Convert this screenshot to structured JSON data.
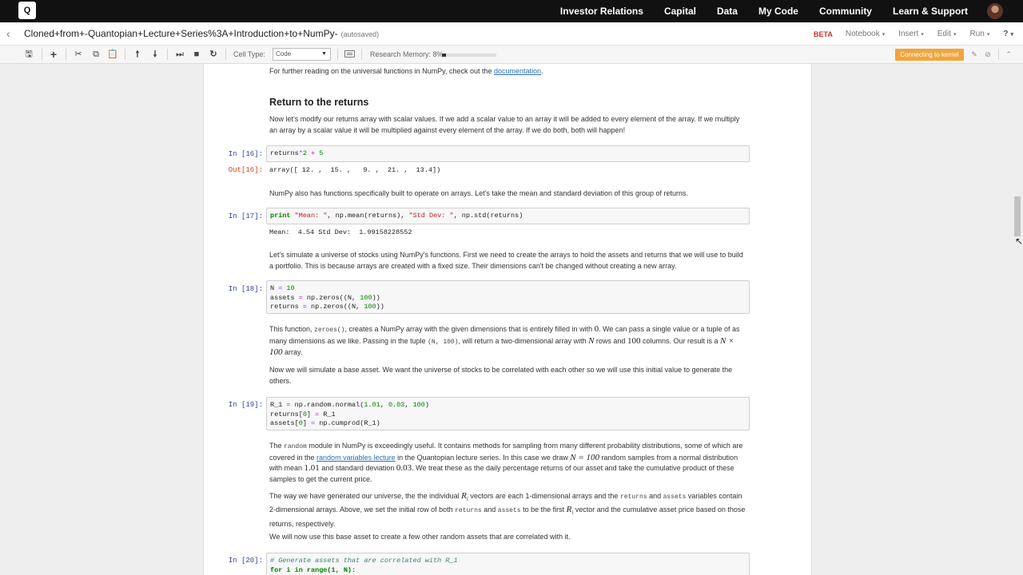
{
  "nav": {
    "logo": "Q",
    "links": [
      "Investor Relations",
      "Capital",
      "Data",
      "My Code",
      "Community",
      "Learn & Support"
    ]
  },
  "titlebar": {
    "title": "Cloned+from+-Quantopian+Lecture+Series%3A+Introduction+to+NumPy-",
    "autosaved": "(autosaved)",
    "beta": "BETA",
    "menus": [
      "Notebook",
      "Insert",
      "Edit",
      "Run",
      "?"
    ]
  },
  "toolbar": {
    "cell_type_label": "Cell Type:",
    "cell_type_value": "Code",
    "memory_label": "Research Memory: 8%",
    "memory_fraction": 0.08,
    "kernel_status": "Connecting to kernel",
    "kernel_color": "#f2a53a"
  },
  "notebook": {
    "md_doc_text": "For further reading on the universal functions in NumPy, check out the ",
    "md_doc_link": "documentation",
    "md_doc_end": ".",
    "heading": "Return to the returns",
    "md_scalar": "Now let's modify our returns array with scalar values. If we add a scalar value to an array it will be added to every element of the array. If we multiply an array by a scalar value it will be multiplied against every element of the array. If we do both, both will happen!",
    "prompt16": "In [16]:",
    "out16": "Out[16]:",
    "out16_text": "array([ 12. ,  15. ,   9. ,  21. ,  13.4])",
    "md_mean": "NumPy also has functions specifically built to operate on arrays. Let's take the mean and standard deviation of this group of returns.",
    "prompt17": "In [17]:",
    "out17_text": "Mean:  4.54 Std Dev:  1.99158228552",
    "md_simulate": "Let's simulate a universe of stocks using NumPy's functions. First we need to create the arrays to hold the assets and returns that we will use to build a portfolio. This is because arrays are created with a fixed size. Their dimensions can't be changed without creating a new array.",
    "prompt18": "In [18]:",
    "md_zeros_1": "This function, ",
    "md_zeros_code": "zeroes()",
    "md_zeros_2": ", creates a NumPy array with the given dimensions that is entirely filled in with ",
    "md_zeros_zero": "0",
    "md_zeros_3": ". We can pass a single value or a tuple of as many dimensions as we like. Passing in the tuple ",
    "md_zeros_tuple": "(N, 100)",
    "md_zeros_4": ", will return a two-dimensional array with ",
    "md_zeros_N": "N",
    "md_zeros_5": " rows and ",
    "md_zeros_100": "100",
    "md_zeros_6": " columns. Our result is a ",
    "md_zeros_dim": "N × 100",
    "md_zeros_7": " array.",
    "md_base": "Now we will simulate a base asset. We want the universe of stocks to be correlated with each other so we will use this initial value to generate the others.",
    "prompt19": "In [19]:",
    "md_random_1": "The ",
    "md_random_code": "random",
    "md_random_2": " module in NumPy is exceedingly useful. It contains methods for sampling from many different probability distributions, some of which are covered in the ",
    "md_random_link": "random variables lecture",
    "md_random_3": " in the Quantopian lecture series. In this case we draw ",
    "md_random_eq": "N = 100",
    "md_random_4": " random samples from a normal distribution with mean ",
    "md_random_mean": "1.01",
    "md_random_5": " and standard deviation ",
    "md_random_sd": "0.03",
    "md_random_6": ". We treat these as the daily percentage returns of our asset and take the cumulative product of these samples to get the current price.",
    "md_universe_1": "The way we have generated our universe, the the individual ",
    "md_universe_R": "R",
    "md_universe_i": "i",
    "md_universe_2": " vectors are each 1-dimensional arrays and the ",
    "md_universe_returns": "returns",
    "md_universe_3": " and ",
    "md_universe_assets": "assets",
    "md_universe_4": " variables contain 2-dimensional arrays. Above, we set the initial row of both ",
    "md_universe_returns2": "returns",
    "md_universe_5": " and ",
    "md_universe_assets2": "assets",
    "md_universe_6": " to be the first ",
    "md_universe_R2": "R",
    "md_universe_i2": "i",
    "md_universe_7": " vector and the cumulative asset price based on those returns, respectively.",
    "md_now": "We will now use this base asset to create a few other random assets that are correlated with it.",
    "prompt20": "In [20]:",
    "code20_comment": "# Generate assets that are correlated with R_1",
    "code20_line2": "for i in range(1, N):"
  }
}
